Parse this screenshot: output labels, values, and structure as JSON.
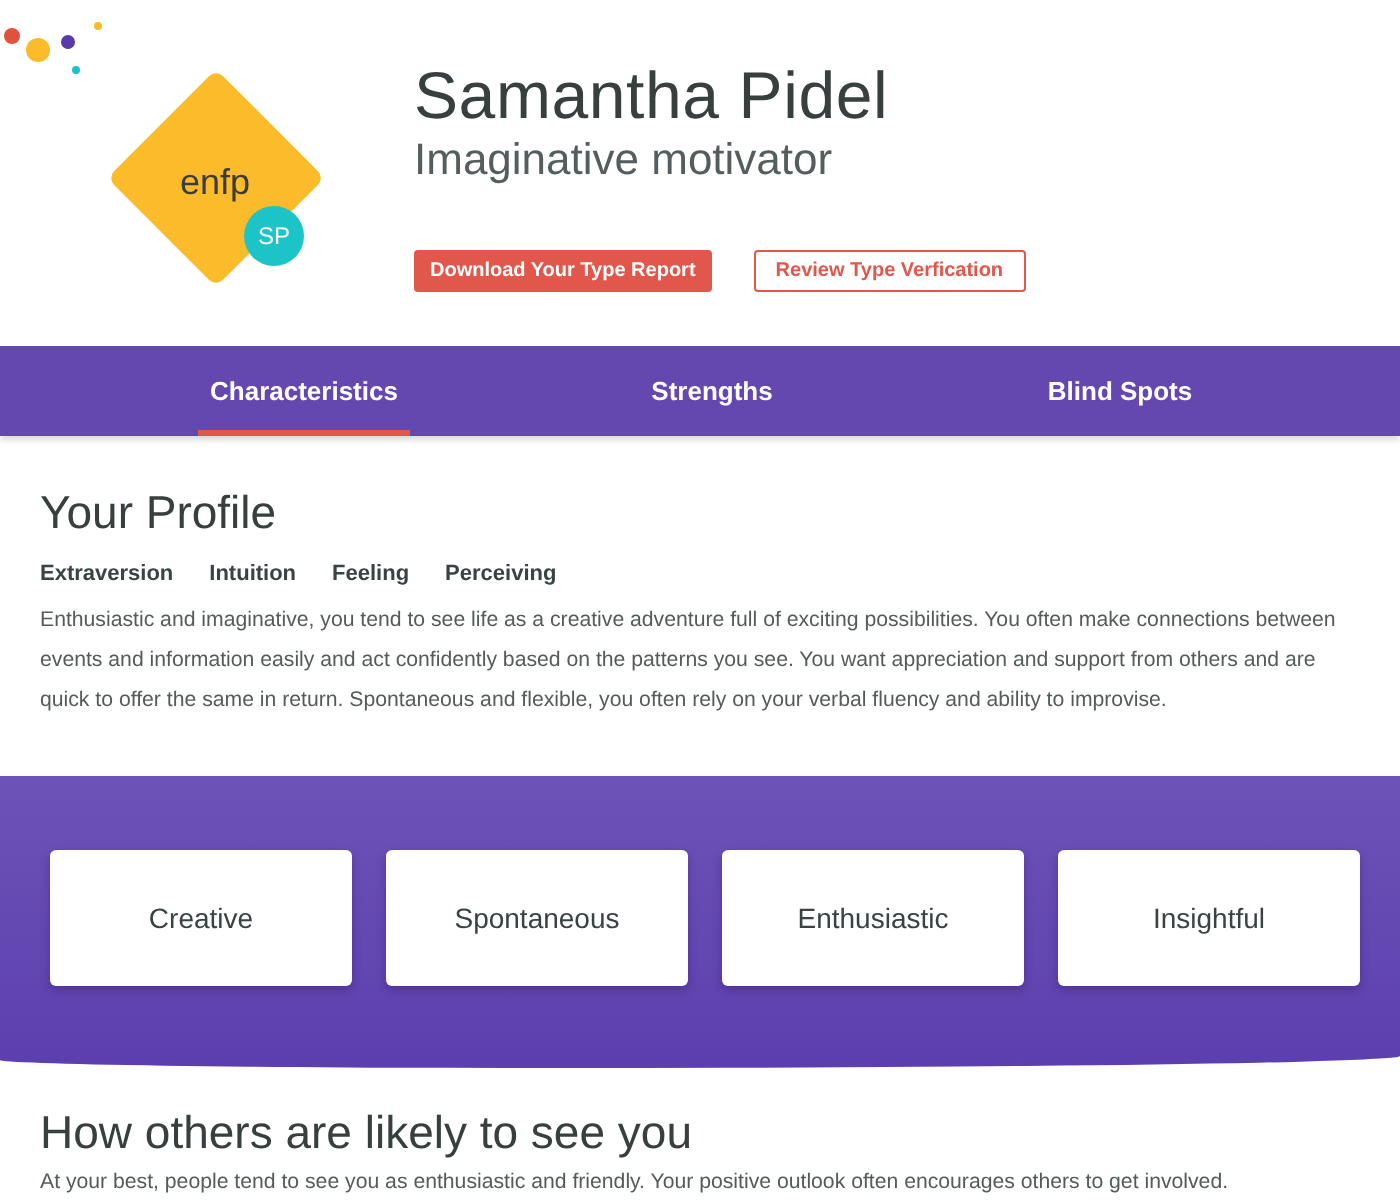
{
  "decoration": {
    "dots": [
      {
        "color": "#e0523f"
      },
      {
        "color": "#fbbb2a"
      },
      {
        "color": "#5a3aaa"
      },
      {
        "color": "#fbbb2a"
      },
      {
        "color": "#1cc4c8"
      }
    ]
  },
  "profile": {
    "type_code": "enfp",
    "initials": "SP",
    "name": "Samantha Pidel",
    "tagline": "Imaginative motivator",
    "buttons": [
      {
        "label": "Download Your Type Report",
        "kind": "primary"
      },
      {
        "label": "Review Type Verfication",
        "kind": "outline"
      }
    ]
  },
  "tabs": [
    {
      "label": "Characteristics",
      "selected": true
    },
    {
      "label": "Strengths",
      "selected": false
    },
    {
      "label": "Blind Spots",
      "selected": false
    }
  ],
  "your_profile": {
    "heading": "Your Profile",
    "preferences": [
      "Extraversion",
      "Intuition",
      "Feeling",
      "Perceiving"
    ],
    "description": "Enthusiastic and imaginative, you tend to see life as a creative adventure full of exciting possibilities. You often make connections between events and information easily and act confidently based on the patterns you see. You want appreciation and support from others and are quick to offer the same in return. Spontaneous and flexible, you often rely on your verbal fluency and ability to improvise."
  },
  "traits": [
    "Creative",
    "Spontaneous",
    "Enthusiastic",
    "Insightful"
  ],
  "others_view": {
    "heading": "How others are likely to see you",
    "text": "At your best, people tend to see you as enthusiastic and friendly. Your positive outlook often encourages others to get involved."
  }
}
